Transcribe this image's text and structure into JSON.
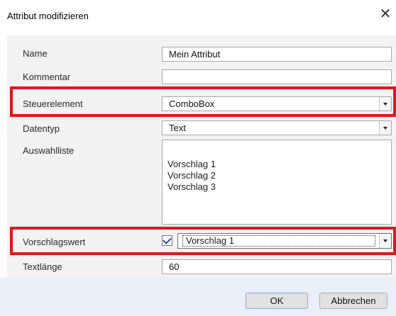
{
  "dialog": {
    "title": "Attribut modifizieren",
    "close_glyph": "✕"
  },
  "form": {
    "name_label": "Name",
    "name_value": "Mein Attribut",
    "comment_label": "Kommentar",
    "comment_value": "",
    "control_label": "Steuerelement",
    "control_value": "ComboBox",
    "datatype_label": "Datentyp",
    "datatype_value": "Text",
    "selection_label": "Auswahlliste",
    "selection_items": [
      "Vorschlag 1",
      "Vorschlag 2",
      "Vorschlag 3"
    ],
    "default_label": "Vorschlagswert",
    "default_checked": true,
    "default_value": "Vorschlag 1",
    "textlength_label": "Textlänge",
    "textlength_value": "60"
  },
  "buttons": {
    "ok": "OK",
    "cancel": "Abbrechen"
  },
  "colors": {
    "highlight": "#e0161e",
    "panel": "#f2f2f2",
    "footer": "#e8eff8"
  },
  "icons": {
    "close": "close-icon",
    "dropdown": "chevron-down-icon",
    "check": "checkmark-icon"
  }
}
